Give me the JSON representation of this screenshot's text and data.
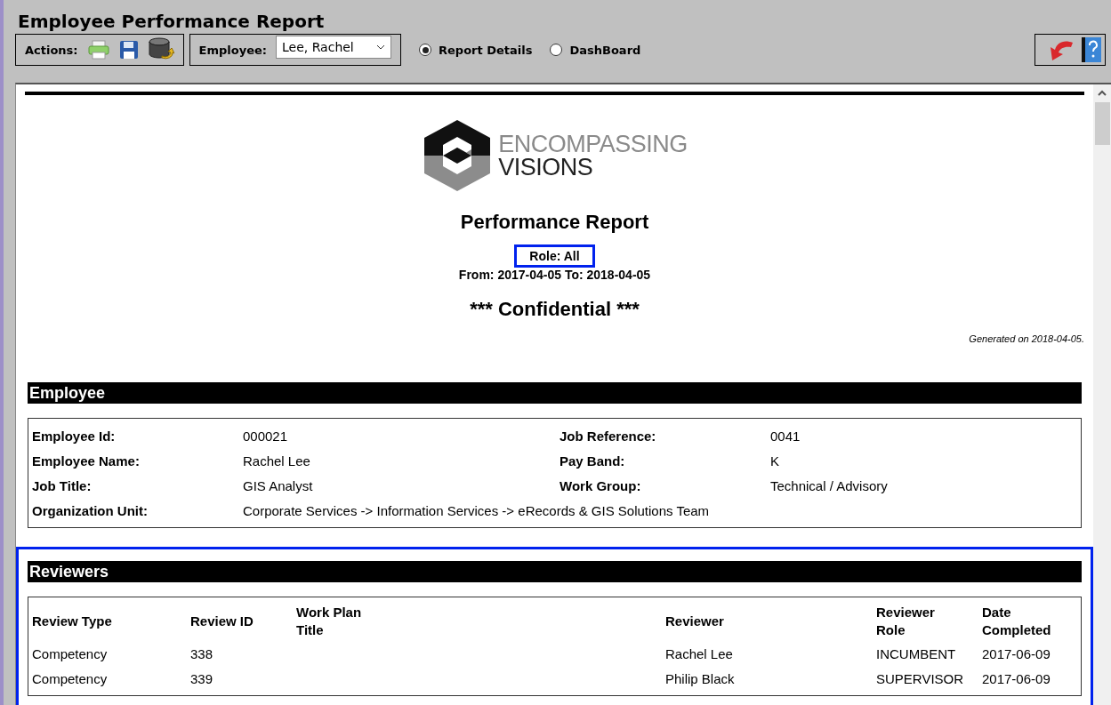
{
  "window": {
    "title": "Employee Performance Report"
  },
  "toolbar": {
    "actions_label": "Actions:",
    "employee_label": "Employee:",
    "employee_value": "Lee, Rachel",
    "views": [
      {
        "label": "Report Details",
        "selected": true
      },
      {
        "label": "DashBoard",
        "selected": false
      }
    ]
  },
  "report": {
    "logo": {
      "line1": "ENCOMPASSING",
      "line2": "VISIONS"
    },
    "title": "Performance Report",
    "role": {
      "text": "Role: All",
      "highlighted": true
    },
    "period": "From: 2017-04-05 To: 2018-04-05",
    "confidential": "*** Confidential ***",
    "generated": "Generated on 2018-04-05.",
    "employee": {
      "heading": "Employee",
      "highlighted": false,
      "rows": [
        {
          "label": "Employee Id:",
          "value": "000021",
          "label2": "Job Reference:",
          "value2": "0041"
        },
        {
          "label": "Employee Name:",
          "value": "Rachel Lee",
          "label2": "Pay Band:",
          "value2": "K"
        },
        {
          "label": "Job Title:",
          "value": "GIS Analyst",
          "label2": "Work Group:",
          "value2": "Technical / Advisory"
        },
        {
          "label": "Organization Unit:",
          "value": "Corporate Services -> Information Services -> eRecords & GIS Solutions Team"
        }
      ]
    },
    "reviewers": {
      "heading": "Reviewers",
      "highlighted": true,
      "columns": [
        "Review Type",
        "Review ID",
        "Work Plan Title",
        "Reviewer",
        "Reviewer Role",
        "Date Completed"
      ],
      "rows": [
        [
          "Competency",
          "338",
          "",
          "Rachel Lee",
          "INCUMBENT",
          "2017-06-09"
        ],
        [
          "Competency",
          "339",
          "",
          "Philip Black",
          "SUPERVISOR",
          "2017-06-09"
        ]
      ]
    }
  }
}
